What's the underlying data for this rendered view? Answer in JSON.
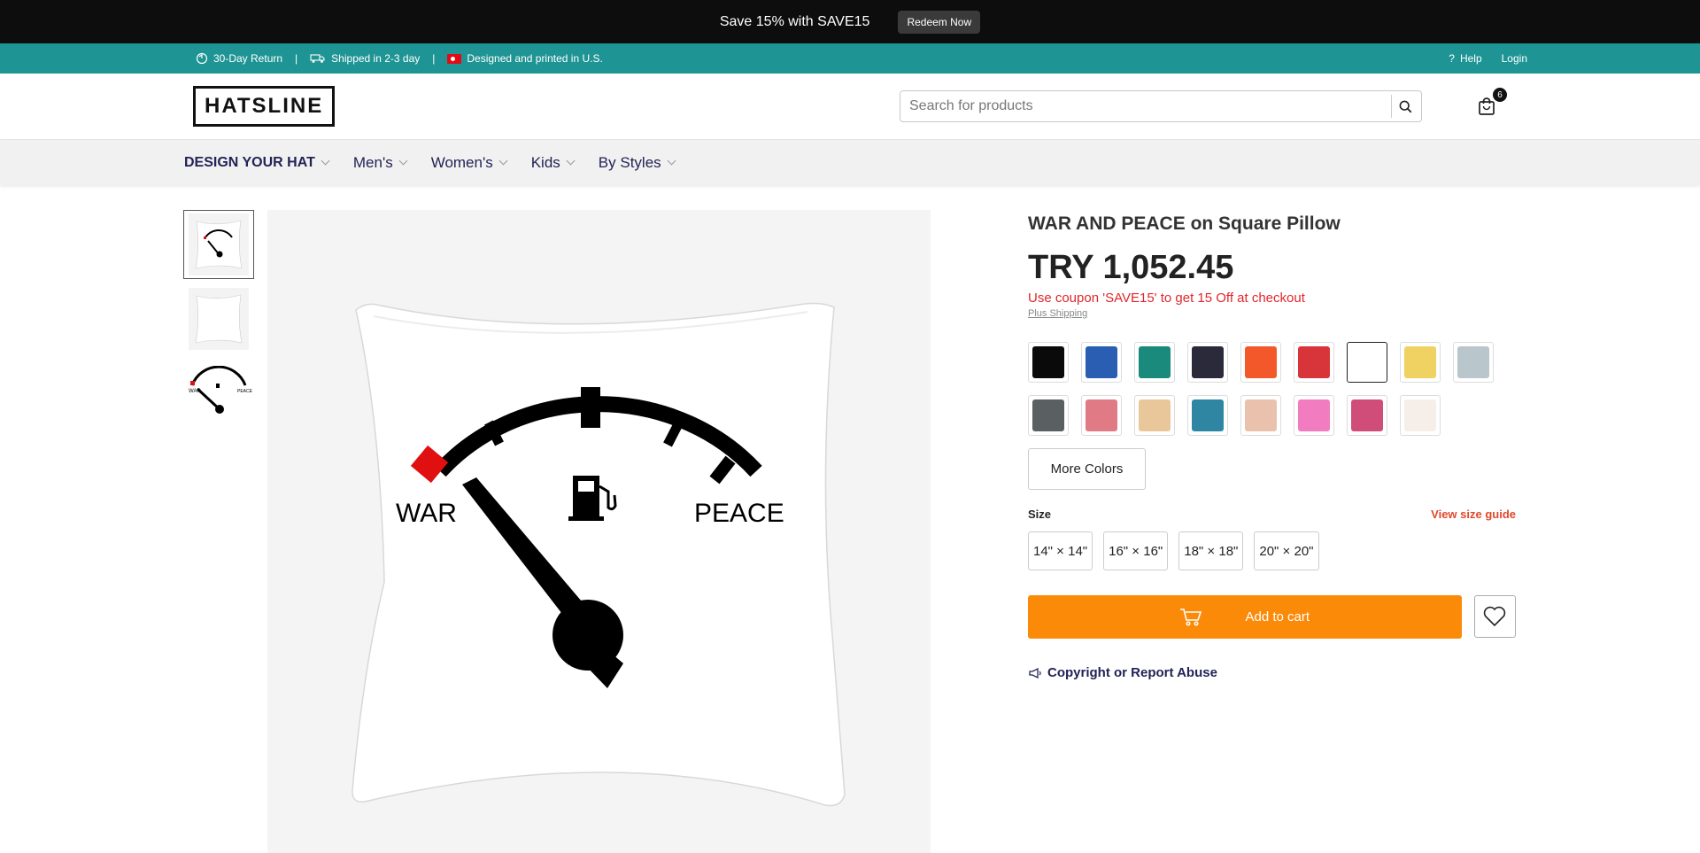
{
  "promo": {
    "text": "Save 15% with SAVE15",
    "button": "Redeem Now"
  },
  "infobar": {
    "return_text": "30-Day Return",
    "shipping_text": "Shipped in 2-3 day",
    "designed_text": "Designed and printed in U.S.",
    "separator": "|",
    "help": "Help",
    "help_glyph": "?",
    "login": "Login"
  },
  "header": {
    "logo": "HATSLINE",
    "search_placeholder": "Search for products",
    "cart_count": "6"
  },
  "nav": {
    "items": [
      {
        "label": "DESIGN YOUR HAT"
      },
      {
        "label": "Men's"
      },
      {
        "label": "Women's"
      },
      {
        "label": "Kids"
      },
      {
        "label": "By Styles"
      }
    ]
  },
  "artwork": {
    "left_label": "WAR",
    "right_label": "PEACE"
  },
  "product": {
    "title": "WAR AND PEACE on Square Pillow",
    "price": "TRY 1,052.45",
    "coupon": "Use coupon 'SAVE15' to get 15 Off at checkout",
    "shipping": "Plus Shipping",
    "colors": [
      "#0a0a0a",
      "#2a5eb3",
      "#1a8a7c",
      "#2b2a3a",
      "#f2582a",
      "#d8353a",
      "#ffffff",
      "#f0d262",
      "#b9c7cd",
      "#5a5f61",
      "#e07b86",
      "#eac79a",
      "#2f86a3",
      "#e9c1ac",
      "#f27cc0",
      "#cf4d78",
      "#f6efe9"
    ],
    "selected_color_index": 6,
    "more_colors": "More Colors",
    "size_label": "Size",
    "size_guide": "View size guide",
    "sizes": [
      "14\" × 14\"",
      "16\" × 16\"",
      "18\" × 18\"",
      "20\" × 20\""
    ],
    "add_to_cart": "Add to cart",
    "report": "Copyright or Report Abuse"
  }
}
